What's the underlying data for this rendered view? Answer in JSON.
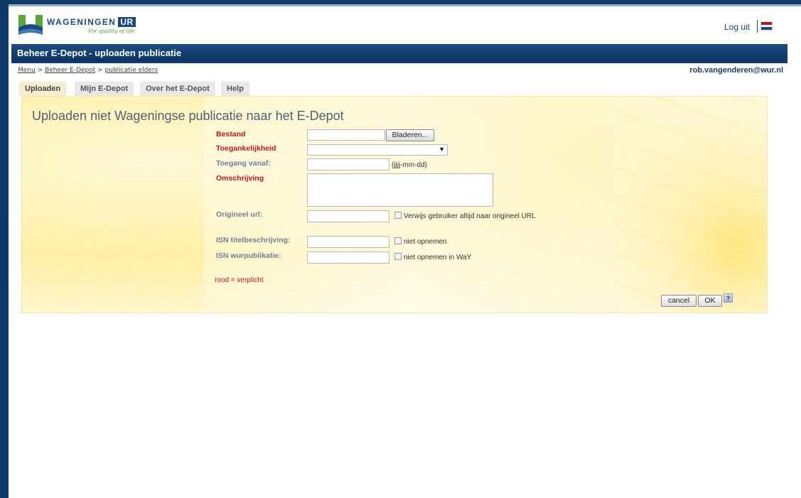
{
  "header": {
    "logo_text": "WAGENINGEN",
    "logo_ur": "UR",
    "logo_tagline": "For quality of life",
    "logout_label": "Log uit",
    "flag_colors": [
      "#ae1c28",
      "#ffffff",
      "#21468b"
    ]
  },
  "titlebar": {
    "title": "Beheer E-Depot - uploaden publicatie"
  },
  "breadcrumb": {
    "items": [
      "Menu",
      "Beheer E-Depot",
      "publicatie elders"
    ],
    "separator": ">"
  },
  "user": {
    "email": "rob.vangenderen@wur.nl"
  },
  "tabs": [
    {
      "label": "Uploaden",
      "active": true
    },
    {
      "label": "Mijn E-Depot",
      "active": false
    },
    {
      "label": "Over het E-Depot",
      "active": false
    },
    {
      "label": "Help",
      "active": false
    }
  ],
  "form": {
    "title": "Uploaden niet Wageningse publicatie naar het E-Depot",
    "fields": {
      "bestand": {
        "label": "Bestand",
        "value": "",
        "button": "Bladeren..."
      },
      "toegankelijkheid": {
        "label": "Toegankelijkheid",
        "value": ""
      },
      "toegang_vanaf": {
        "label": "Toegang vanaf:",
        "value": "",
        "hint": "(jjjj-mm-dd)"
      },
      "omschrijving": {
        "label": "Omschrijving",
        "value": ""
      },
      "origineel_url": {
        "label": "Origineel url:",
        "value": "",
        "checkbox": "Verwijs gebruiker altijd naar origineel URL"
      },
      "isn_titel": {
        "label": "ISN titelbeschrijving:",
        "value": "",
        "checkbox": "niet opnemen"
      },
      "isn_wur": {
        "label": "ISN wurpublikatie:",
        "value": "",
        "checkbox": "niet opnemen in WaY"
      }
    },
    "required_note": "rood = verplicht",
    "cancel_label": "cancel",
    "ok_label": "OK",
    "help_label": "?"
  },
  "colors": {
    "required": "#c8141e",
    "titlebar": "#0b3264",
    "label": "#6f7f99"
  }
}
